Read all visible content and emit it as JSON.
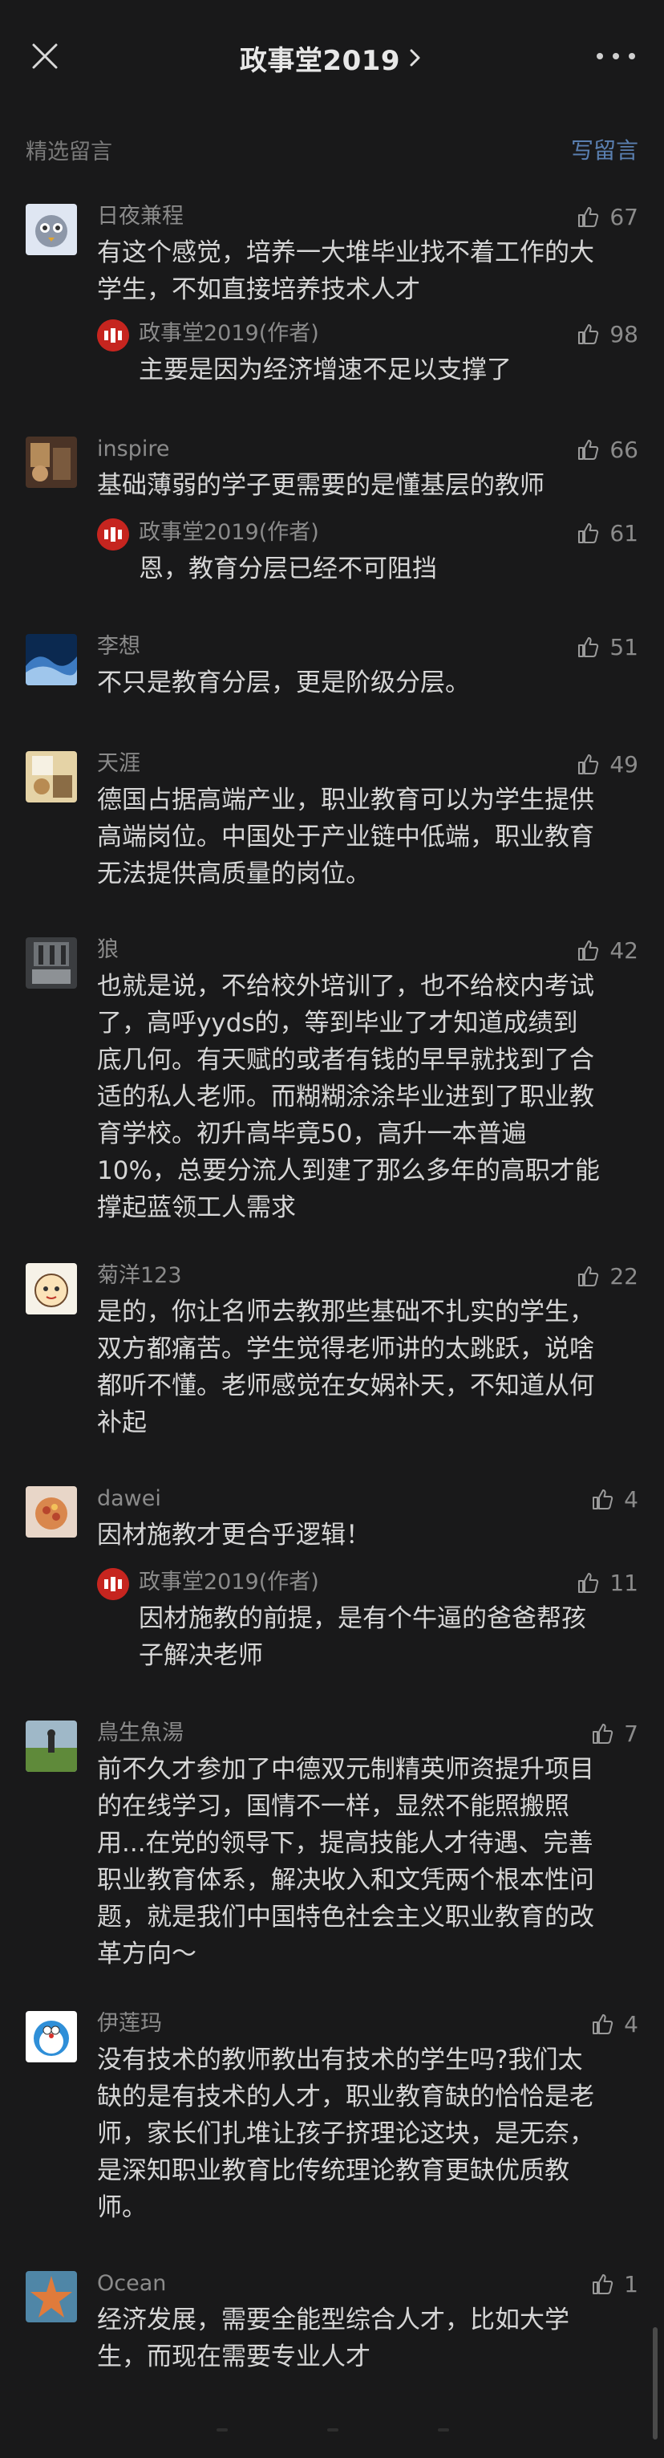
{
  "header": {
    "title": "政事堂2019",
    "close_icon": "close-icon",
    "more_icon": "more-icon"
  },
  "section": {
    "title": "精选留言",
    "write_label": "写留言"
  },
  "comments": [
    {
      "name": "日夜兼程",
      "likes": "67",
      "text": [
        "有这个感觉，培养一大堆毕业找不着工作的大",
        "学生，不如直接培养技术人才"
      ],
      "reply": {
        "name": "政事堂2019(作者)",
        "likes": "98",
        "text": [
          "主要是因为经济增速不足以支撑了"
        ]
      }
    },
    {
      "name": "inspire",
      "likes": "66",
      "text": [
        "基础薄弱的学子更需要的是懂基层的教师"
      ],
      "reply": {
        "name": "政事堂2019(作者)",
        "likes": "61",
        "text": [
          "恩，教育分层已经不可阻挡"
        ]
      }
    },
    {
      "name": "李想",
      "likes": "51",
      "text": [
        "不只是教育分层，更是阶级分层。"
      ]
    },
    {
      "name": "天涯",
      "likes": "49",
      "text": [
        "德国占据高端产业，职业教育可以为学生提供",
        "高端岗位。中国处于产业链中低端，职业教育",
        "无法提供高质量的岗位。"
      ]
    },
    {
      "name": "狼",
      "likes": "42",
      "text": [
        "也就是说，不给校外培训了，也不给校内考试",
        "了，高呼yyds的，等到毕业了才知道成绩到",
        "底几何。有天赋的或者有钱的早早就找到了合",
        "适的私人老师。而糊糊涂涂毕业进到了职业教",
        "育学校。初升高毕竟50，高升一本普遍",
        "10%，总要分流人到建了那么多年的高职才能",
        "撑起蓝领工人需求"
      ]
    },
    {
      "name": "菊洋123",
      "likes": "22",
      "text": [
        "是的，你让名师去教那些基础不扎实的学生，",
        "双方都痛苦。学生觉得老师讲的太跳跃，说啥",
        "都听不懂。老师感觉在女娲补天，不知道从何",
        "补起"
      ]
    },
    {
      "name": "dawei",
      "likes": "4",
      "text": [
        "因材施教才更合乎逻辑！"
      ],
      "reply": {
        "name": "政事堂2019(作者)",
        "likes": "11",
        "text": [
          "因材施教的前提，是有个牛逼的爸爸帮孩",
          "子解决老师"
        ]
      }
    },
    {
      "name": "鳥生魚湯",
      "likes": "7",
      "text": [
        "前不久才参加了中德双元制精英师资提升项目",
        "的在线学习，国情不一样，显然不能照搬照",
        "用...在党的领导下，提高技能人才待遇、完善",
        "职业教育体系，解决收入和文凭两个根本性问",
        "题，就是我们中国特色社会主义职业教育的改",
        "革方向～"
      ]
    },
    {
      "name": "伊莲玛",
      "likes": "4",
      "text": [
        "没有技术的教师教出有技术的学生吗?我们太",
        "缺的是有技术的人才，职业教育缺的恰恰是老",
        "师，家长们扎堆让孩子挤理论这块，是无奈，",
        "是深知职业教育比传统理论教育更缺优质教",
        "师。"
      ]
    },
    {
      "name": "Ocean",
      "likes": "1",
      "text": [
        "经济发展，需要全能型综合人才，比如大学",
        "生，而现在需要专业人才"
      ]
    }
  ],
  "colors": {
    "background": "#19191a",
    "text": "#d6d6d6",
    "muted": "#8b8b8b",
    "link": "#5a7fb0",
    "author_badge": "#c6251f"
  }
}
